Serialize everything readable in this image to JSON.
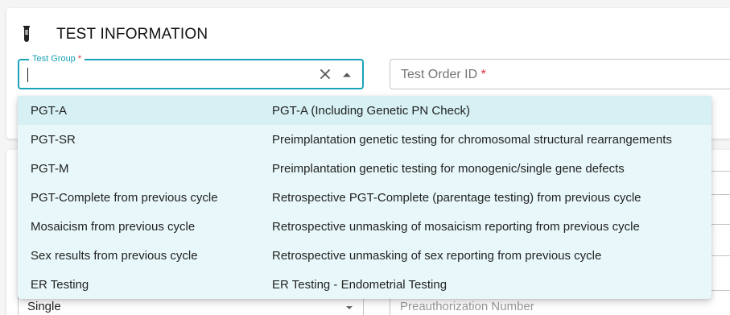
{
  "section": {
    "title": "TEST INFORMATION",
    "icon": "test-tube-icon"
  },
  "test_group": {
    "label": "Test Group",
    "required_mark": "*",
    "value": ""
  },
  "test_order_id": {
    "placeholder": "Test Order ID",
    "required_mark": "*"
  },
  "options": [
    {
      "code": "PGT-A",
      "description": "PGT-A (Including Genetic PN Check)"
    },
    {
      "code": "PGT-SR",
      "description": "Preimplantation genetic testing for chromosomal structural rearrangements"
    },
    {
      "code": "PGT-M",
      "description": "Preimplantation genetic testing for monogenic/single gene defects"
    },
    {
      "code": "PGT-Complete from previous cycle",
      "description": "Retrospective PGT-Complete (parentage testing) from previous cycle"
    },
    {
      "code": "Mosaicism from previous cycle",
      "description": "Retrospective unmasking of mosaicism reporting from previous cycle"
    },
    {
      "code": "Sex results from previous cycle",
      "description": "Retrospective unmasking of sex reporting from previous cycle"
    },
    {
      "code": "ER Testing",
      "description": "ER Testing - Endometrial Testing"
    }
  ],
  "background": {
    "single_value": "Single",
    "preauth_placeholder": "Preauthorization Number"
  },
  "colors": {
    "accent": "#1aa3b8",
    "required": "#e0293c",
    "dropdown_bg": "#e8f7f9",
    "highlight_bg": "#d6f0f4"
  }
}
